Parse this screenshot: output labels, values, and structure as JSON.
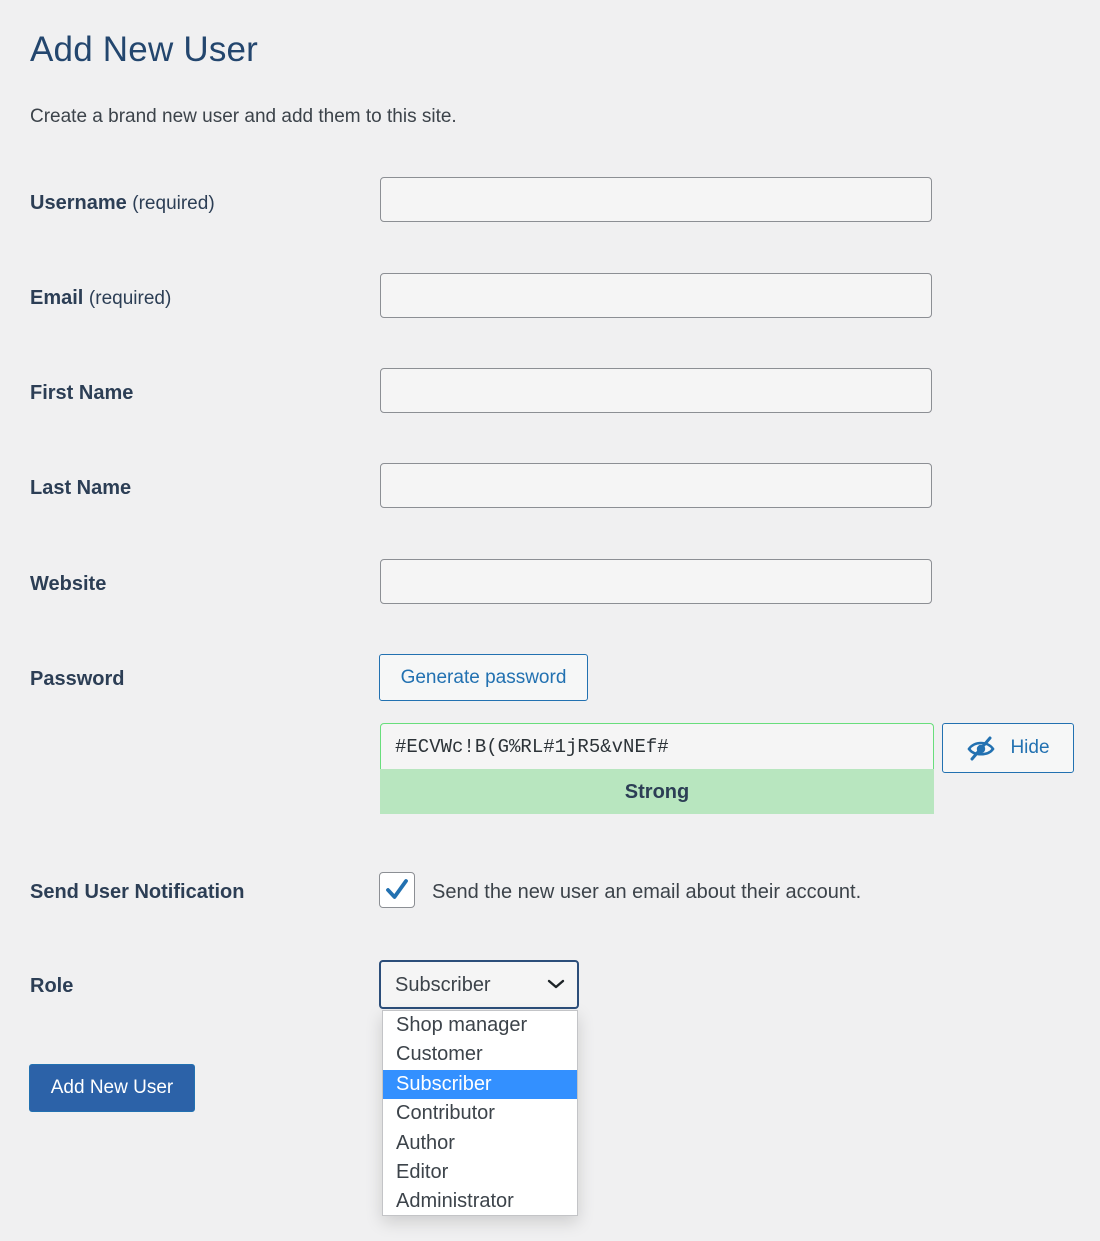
{
  "page": {
    "title": "Add New User",
    "description": "Create a brand new user and add them to this site."
  },
  "form": {
    "username": {
      "label": "Username",
      "qualifier": "(required)",
      "value": ""
    },
    "email": {
      "label": "Email",
      "qualifier": "(required)",
      "value": ""
    },
    "first_name": {
      "label": "First Name",
      "value": ""
    },
    "last_name": {
      "label": "Last Name",
      "value": ""
    },
    "website": {
      "label": "Website",
      "value": ""
    },
    "password": {
      "label": "Password",
      "generate_button": "Generate password",
      "value": "#ECVWc!B(G%RL#1jR5&vNEf#",
      "strength": "Strong",
      "hide_button": "Hide",
      "hide_icon": "hidden-eye-icon"
    },
    "notification": {
      "label": "Send User Notification",
      "checked": true,
      "checkbox_text": "Send the new user an email about their account."
    },
    "role": {
      "label": "Role",
      "selected": "Subscriber",
      "options": [
        "Shop manager",
        "Customer",
        "Subscriber",
        "Contributor",
        "Author",
        "Editor",
        "Administrator"
      ]
    },
    "submit_button": "Add New User"
  },
  "colors": {
    "background": "#f0f0f1",
    "title": "#23466e",
    "accent": "#2271b1",
    "strong_meter": "#b8e6bf",
    "dropdown_highlight": "#3390ff",
    "primary_button": "#2c62a8"
  }
}
